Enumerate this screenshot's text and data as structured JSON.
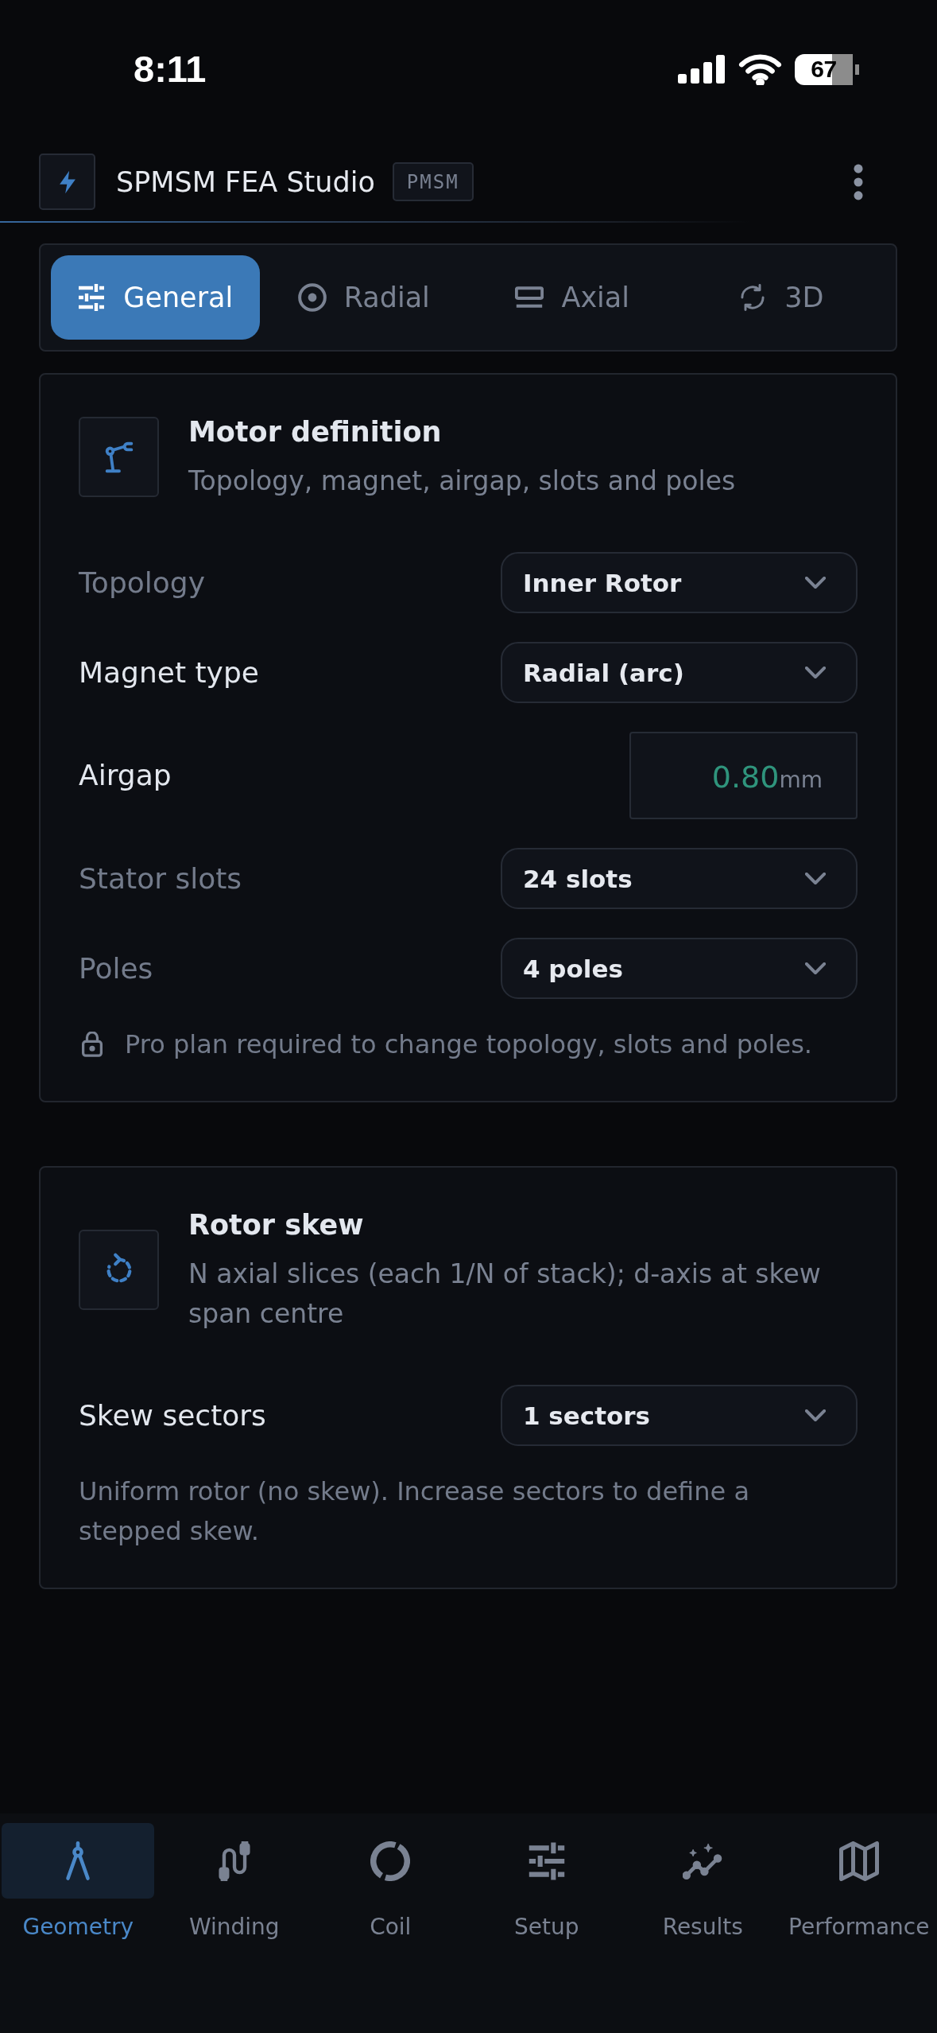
{
  "status_bar": {
    "time": "8:11",
    "battery": "67"
  },
  "header": {
    "title": "SPMSM FEA Studio",
    "badge": "PMSM"
  },
  "tabs": [
    {
      "label": "General",
      "selected": true
    },
    {
      "label": "Radial",
      "selected": false
    },
    {
      "label": "Axial",
      "selected": false
    },
    {
      "label": "3D",
      "selected": false
    }
  ],
  "motor_definition": {
    "title": "Motor definition",
    "subtitle": "Topology, magnet, airgap, slots and poles",
    "fields": [
      {
        "kind": "select",
        "label": "Topology",
        "value": "Inner Rotor",
        "disabled": true
      },
      {
        "kind": "select",
        "label": "Magnet type",
        "value": "Radial (arc)",
        "disabled": false
      },
      {
        "kind": "number",
        "label": "Airgap",
        "value": "0.80",
        "unit": "mm",
        "disabled": false
      },
      {
        "kind": "select",
        "label": "Stator slots",
        "value": "24 slots",
        "disabled": true
      },
      {
        "kind": "select",
        "label": "Poles",
        "value": "4 poles",
        "disabled": true
      }
    ],
    "note": {
      "text": "Pro plan required to change topology, slots and poles.",
      "locked": true
    }
  },
  "rotor_skew": {
    "title": "Rotor skew",
    "subtitle": "N axial slices (each 1/N of stack); d-axis at skew span centre",
    "fields": [
      {
        "kind": "select",
        "label": "Skew sectors",
        "value": "1 sectors",
        "disabled": false
      }
    ],
    "note": {
      "text": "Uniform rotor (no skew). Increase sectors to define a stepped skew.",
      "locked": false
    }
  },
  "bottom_nav": [
    {
      "label": "Geometry",
      "selected": true
    },
    {
      "label": "Winding",
      "selected": false
    },
    {
      "label": "Coil",
      "selected": false
    },
    {
      "label": "Setup",
      "selected": false
    },
    {
      "label": "Results",
      "selected": false
    },
    {
      "label": "Performance",
      "selected": false
    }
  ]
}
